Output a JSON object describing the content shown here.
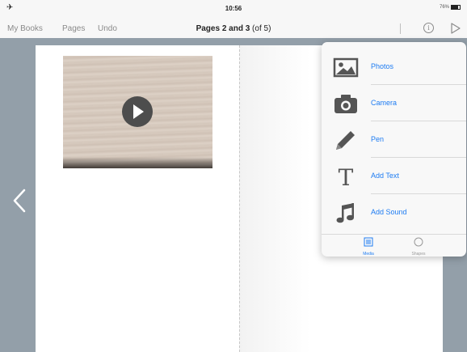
{
  "status_bar": {
    "time": "10:56",
    "battery_pct": "76%",
    "battery_level": 0.76
  },
  "nav": {
    "my_books": "My Books",
    "pages": "Pages",
    "undo": "Undo",
    "title_bold": "Pages 2 and 3",
    "title_suffix": " (of 5)"
  },
  "popover": {
    "items": [
      {
        "label": "Photos",
        "icon": "photos-icon"
      },
      {
        "label": "Camera",
        "icon": "camera-icon"
      },
      {
        "label": "Pen",
        "icon": "pen-icon"
      },
      {
        "label": "Add Text",
        "icon": "text-icon"
      },
      {
        "label": "Add Sound",
        "icon": "music-note-icon"
      }
    ],
    "tabs": [
      {
        "label": "Media",
        "selected": true
      },
      {
        "label": "Shapes",
        "selected": false
      }
    ]
  },
  "colors": {
    "accent": "#1e7cf2",
    "icon_gray": "#555555",
    "workspace": "#939fa9"
  }
}
